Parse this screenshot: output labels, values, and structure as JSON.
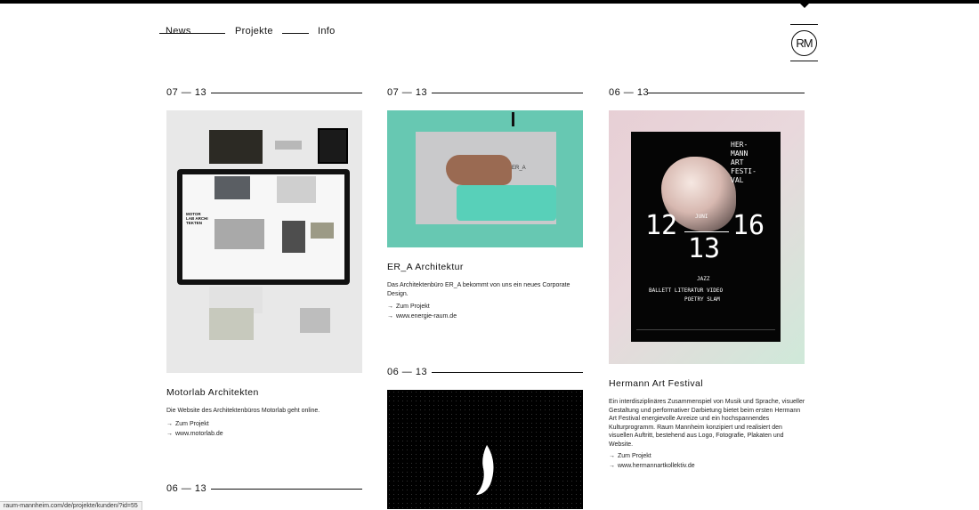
{
  "nav": {
    "items": [
      {
        "label": "News"
      },
      {
        "label": "Projekte"
      },
      {
        "label": "Info"
      }
    ]
  },
  "logo": {
    "text": "RM"
  },
  "columns": [
    {
      "projects": [
        {
          "date": "07 — 13",
          "title": "Motorlab Architekten",
          "description": "Die Website des Architektenbüros Motorlab geht online.",
          "links": [
            {
              "label": "Zum Projekt"
            },
            {
              "label": "www.motorlab.de"
            }
          ],
          "thumbnail": {
            "screen_text": "MOTOR LAB ARCHI TEKTEN"
          }
        },
        {
          "date": "06 — 13"
        }
      ]
    },
    {
      "projects": [
        {
          "date": "07 — 13",
          "title": "ER_A Architektur",
          "description": "Das Architektenbüro ER_A bekommt von uns ein neues Corporate Design.",
          "links": [
            {
              "label": "Zum Projekt"
            },
            {
              "label": "www.energie-raum.de"
            }
          ],
          "thumbnail": {
            "card_text": "ER_A"
          }
        },
        {
          "date": "06 — 13"
        }
      ]
    },
    {
      "projects": [
        {
          "date": "06 — 13",
          "title": "Hermann Art Festival",
          "description": "Ein interdisziplinäres Zusammenspiel von Musik und Sprache, visueller Gestaltung und performativer Darbietung bietet beim ersten Hermann Art Festival energievolle Anreize und ein hochspannendes Kulturprogramm. Raum Mannheim konzipiert und realisiert den visuellen Auftritt, bestehend aus Logo, Fotografie, Plakaten und Website.",
          "links": [
            {
              "label": "Zum Projekt"
            },
            {
              "label": "www.hermannartkollektiv.de"
            }
          ],
          "poster": {
            "title_lines": [
              "HER-",
              "MANN",
              "ART",
              "FESTI-",
              "VAL"
            ],
            "day_start": "12",
            "month": "JUNI",
            "day_end": "16",
            "year": "13",
            "genre_top": "JAZZ",
            "genres": "BALLETT  LITERATUR  VIDEO",
            "genre_bottom": "POETRY SLAM"
          }
        }
      ]
    }
  ],
  "arrow_glyph": "→",
  "status_bar": {
    "url": "raum-mannheim.com/de/projekte/kunden/?id=55"
  }
}
